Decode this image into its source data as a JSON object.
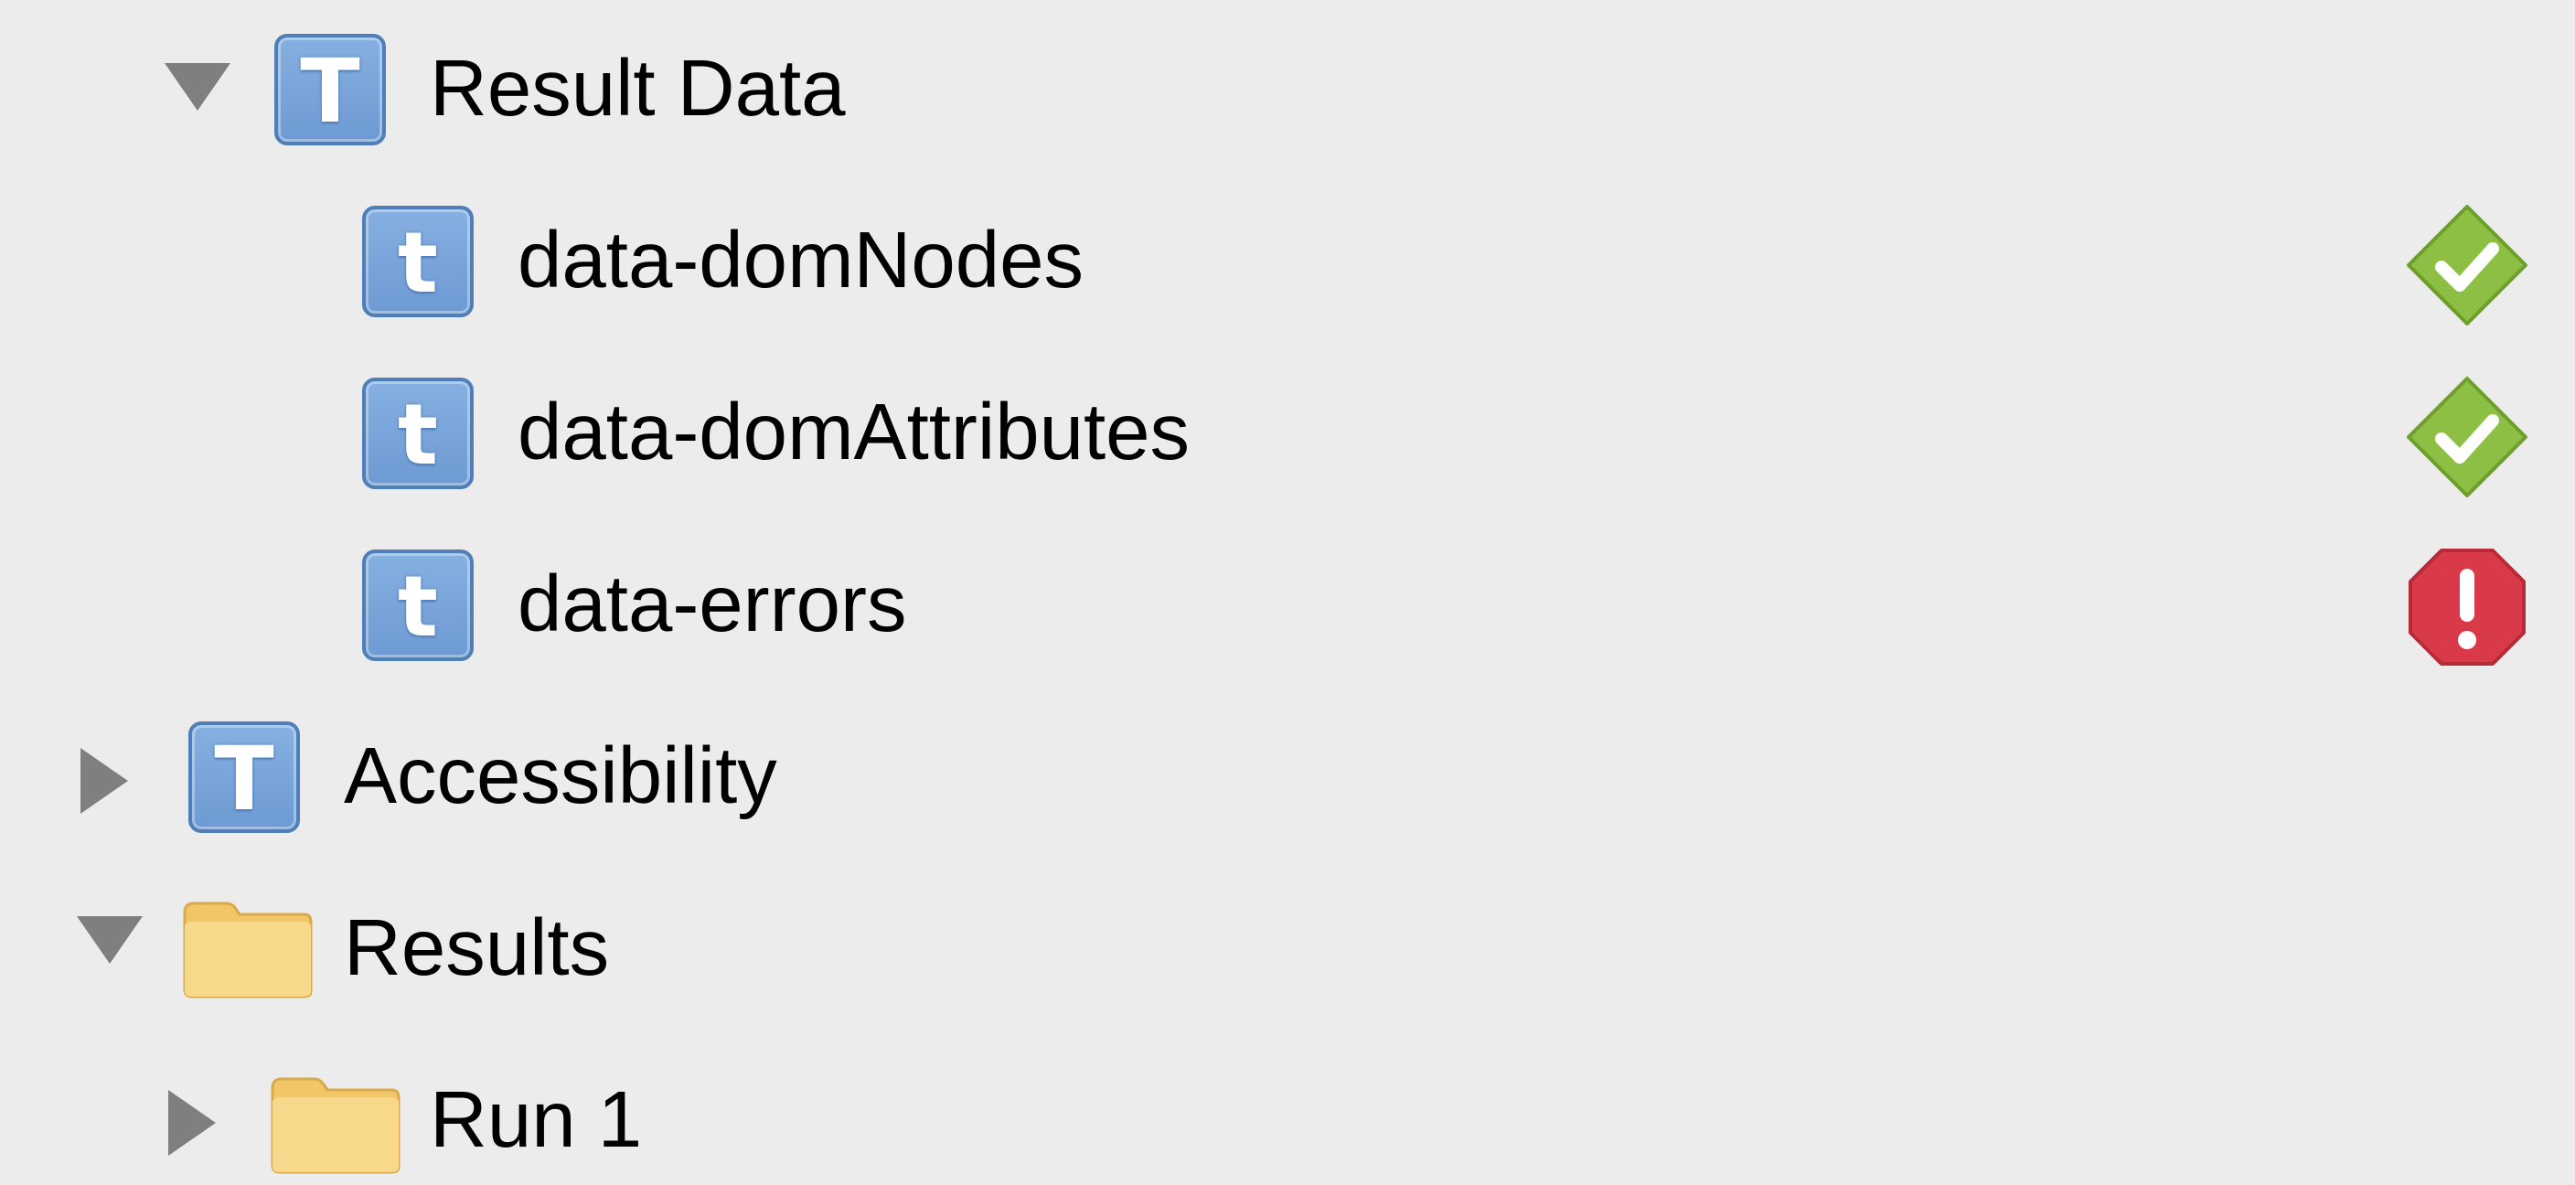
{
  "tree": {
    "result_data": {
      "label": "Result Data",
      "type_icon": "T",
      "expanded": true,
      "icon": "group-template-icon"
    },
    "items": [
      {
        "label": "data-domNodes",
        "type_icon": "t",
        "status": "passed",
        "status_icon": "check-diamond-icon"
      },
      {
        "label": "data-domAttributes",
        "type_icon": "t",
        "status": "passed",
        "status_icon": "check-diamond-icon"
      },
      {
        "label": "data-errors",
        "type_icon": "t",
        "status": "error",
        "status_icon": "error-octagon-icon"
      }
    ],
    "accessibility": {
      "label": "Accessibility",
      "type_icon": "T",
      "expanded": false
    },
    "results": {
      "label": "Results",
      "icon": "folder-icon",
      "expanded": true
    },
    "run1": {
      "label": "Run 1",
      "icon": "folder-icon",
      "expanded": false
    }
  },
  "colors": {
    "background": "#ececec",
    "type_icon": "#7aa6dc",
    "folder": "#f6cf76",
    "passed": "#8cbf43",
    "error": "#d83a4a",
    "disclosure": "#7f7f7f"
  }
}
